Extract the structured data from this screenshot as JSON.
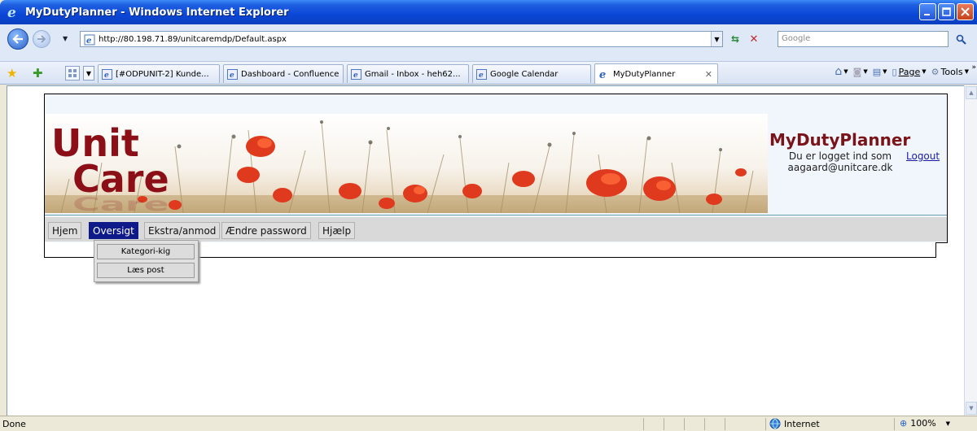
{
  "window": {
    "title": "MyDutyPlanner - Windows Internet Explorer"
  },
  "address": {
    "url": "http://80.198.71.89/unitcaremdp/Default.aspx",
    "search_placeholder": "Google"
  },
  "tabs": [
    {
      "label": "[#ODPUNIT-2] Kunde..."
    },
    {
      "label": "Dashboard - Confluence"
    },
    {
      "label": "Gmail - Inbox - heh62..."
    },
    {
      "label": "Google Calendar"
    },
    {
      "label": "MyDutyPlanner",
      "active": true
    }
  ],
  "commands": {
    "page": "Page",
    "tools": "Tools"
  },
  "site": {
    "logo_line1": "Unit",
    "logo_line2": "Care",
    "brand": "MyDutyPlanner",
    "logged_in_line1": "Du er logget ind som",
    "logged_in_line2": "aagaard@unitcare.dk",
    "logout": "Logout",
    "menu": [
      {
        "label": "Hjem"
      },
      {
        "label": "Oversigt",
        "active": true
      },
      {
        "label": "Ekstra/anmod"
      },
      {
        "label": "Ændre password"
      },
      {
        "label": "Hjælp"
      }
    ],
    "dropdown": [
      {
        "label": "Kategori-kig"
      },
      {
        "label": "Læs post"
      }
    ]
  },
  "status": {
    "text": "Done",
    "zone": "Internet",
    "zoom": "100%"
  },
  "colors": {
    "brand": "#7b1419",
    "menu_active": "#0e1a8a",
    "titlebar": "#0a46d6"
  }
}
